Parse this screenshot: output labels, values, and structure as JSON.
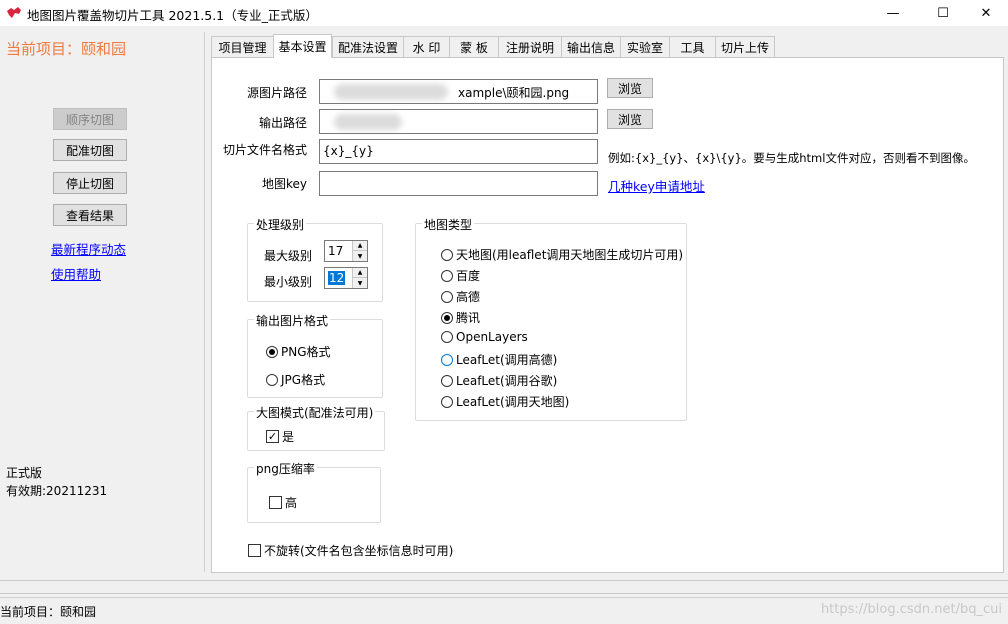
{
  "window": {
    "title": "地图图片覆盖物切片工具 2021.5.1（专业_正式版）",
    "minimize": "—",
    "maximize": "☐",
    "close": "✕"
  },
  "left": {
    "project_title": "当前项目：颐和园",
    "buttons": [
      "顺序切图",
      "配准切图",
      "停止切图",
      "查看结果"
    ],
    "links": [
      "最新程序动态",
      "使用帮助"
    ],
    "edition": "正式版",
    "validity": "有效期:20211231"
  },
  "tabs": [
    "项目管理",
    "基本设置",
    "配准法设置",
    "水 印",
    "蒙 板",
    "注册说明",
    "输出信息",
    "实验室",
    "工具",
    "切片上传"
  ],
  "form": {
    "src_label": "源图片路径",
    "src_value": "xample\\颐和园.png",
    "out_label": "输出路径",
    "out_value": "",
    "browse": "浏览",
    "fname_label": "切片文件名格式",
    "fname_value": "{x}_{y}",
    "fname_hint": "例如:{x}_{y}、{x}\\{y}。要与生成html文件对应，否则看不到图像。",
    "key_label": "地图key",
    "key_value": "",
    "key_link": "几种key申请地址"
  },
  "levels": {
    "title": "处理级别",
    "max_label": "最大级别",
    "max_value": "17",
    "min_label": "最小级别",
    "min_value": "12"
  },
  "format": {
    "title": "输出图片格式",
    "options": [
      "PNG格式",
      "JPG格式"
    ],
    "selected": "PNG格式"
  },
  "bigmode": {
    "title": "大图模式(配准法可用)",
    "check_label": "是",
    "checked": true
  },
  "png_compress": {
    "title": "png压缩率",
    "check_label": "高",
    "checked": false
  },
  "no_rotate": {
    "label": "不旋转(文件名包含坐标信息时可用)",
    "checked": false
  },
  "maptype": {
    "title": "地图类型",
    "options": [
      "天地图(用leaflet调用天地图生成切片可用)",
      "百度",
      "高德",
      "腾讯",
      "OpenLayers",
      "LeafLet(调用高德)",
      "LeafLet(调用谷歌)",
      "LeafLet(调用天地图)"
    ],
    "selected": "腾讯"
  },
  "statusbar": {
    "text": "当前项目：颐和园",
    "watermark": "https://blog.csdn.net/bq_cui"
  },
  "colors": {
    "accent": "#f07a3e",
    "link": "#0000ff",
    "selection": "#0078d7"
  }
}
